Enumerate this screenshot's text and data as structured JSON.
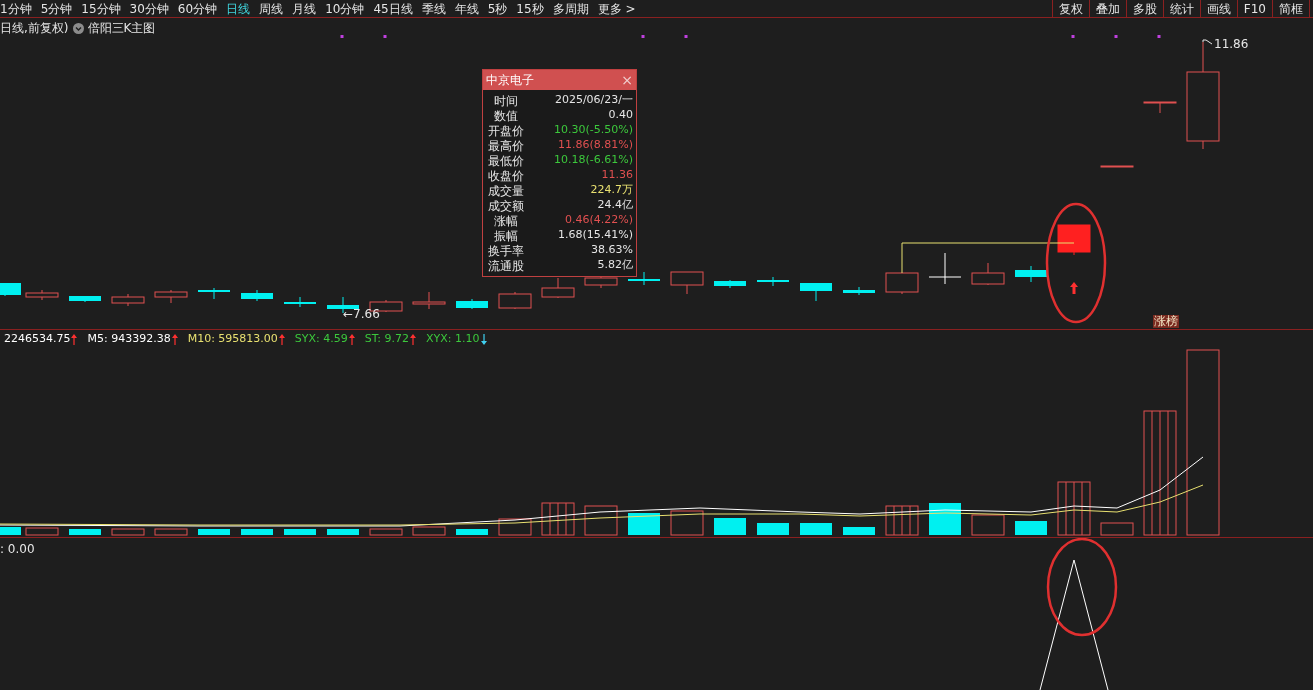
{
  "toolbar": {
    "periods": [
      {
        "label": "1分钟",
        "selected": false
      },
      {
        "label": "5分钟",
        "selected": false
      },
      {
        "label": "15分钟",
        "selected": false
      },
      {
        "label": "30分钟",
        "selected": false
      },
      {
        "label": "60分钟",
        "selected": false
      },
      {
        "label": "日线",
        "selected": true
      },
      {
        "label": "周线",
        "selected": false
      },
      {
        "label": "月线",
        "selected": false
      },
      {
        "label": "10分钟",
        "selected": false
      },
      {
        "label": "45日线",
        "selected": false
      },
      {
        "label": "季线",
        "selected": false
      },
      {
        "label": "年线",
        "selected": false
      },
      {
        "label": "5秒",
        "selected": false
      },
      {
        "label": "15秒",
        "selected": false
      },
      {
        "label": "多周期",
        "selected": false
      },
      {
        "label": "更多 >",
        "selected": false
      }
    ],
    "buttons": [
      "复权",
      "叠加",
      "多股",
      "统计",
      "画线",
      "F10",
      "简框"
    ]
  },
  "main_chart": {
    "title": "日线,前复权)",
    "indicator": "倍阳三K主图",
    "low_label": "←7.66",
    "high_label": "11.86",
    "badge": "涨榜"
  },
  "tooltip": {
    "title": "中京电子",
    "close": "×",
    "rows": [
      {
        "label": "时间",
        "value": "2025/06/23/一",
        "color": "#e6e6e6"
      },
      {
        "label": "数值",
        "value": "0.40",
        "color": "#e6e6e6"
      },
      {
        "label": "开盘价",
        "value": "10.30(-5.50%)",
        "color": "#3cc83c"
      },
      {
        "label": "最高价",
        "value": "11.86(8.81%)",
        "color": "#e05050"
      },
      {
        "label": "最低价",
        "value": "10.18(-6.61%)",
        "color": "#3cc83c"
      },
      {
        "label": "收盘价",
        "value": "11.36",
        "color": "#e05050"
      },
      {
        "label": "成交量",
        "value": "224.7万",
        "color": "#e8e070"
      },
      {
        "label": "成交额",
        "value": "24.4亿",
        "color": "#e6e6e6"
      },
      {
        "label": "涨幅",
        "value": "0.46(4.22%)",
        "color": "#e05050"
      },
      {
        "label": "振幅",
        "value": "1.68(15.41%)",
        "color": "#e6e6e6"
      },
      {
        "label": "换手率",
        "value": "38.63%",
        "color": "#e6e6e6"
      },
      {
        "label": "流通股",
        "value": "5.82亿",
        "color": "#e6e6e6"
      }
    ]
  },
  "volume_panel": {
    "legend": [
      {
        "text": "2246534.75",
        "color": "#ffffff",
        "kind": "rising"
      },
      {
        "text": "M5: 943392.38",
        "color": "#ffffff",
        "kind": "rising"
      },
      {
        "text": "M10: 595813.00",
        "color": "#e8e070",
        "kind": "rising"
      },
      {
        "text": "SYX: 4.59",
        "color": "#3cc83c",
        "kind": "rising"
      },
      {
        "text": "ST: 9.72",
        "color": "#3cc83c",
        "kind": "rising"
      },
      {
        "text": "XYX: 1.10",
        "color": "#3cc83c",
        "kind": "falling"
      }
    ]
  },
  "lower_panel": {
    "label": ": 0.00"
  }
}
